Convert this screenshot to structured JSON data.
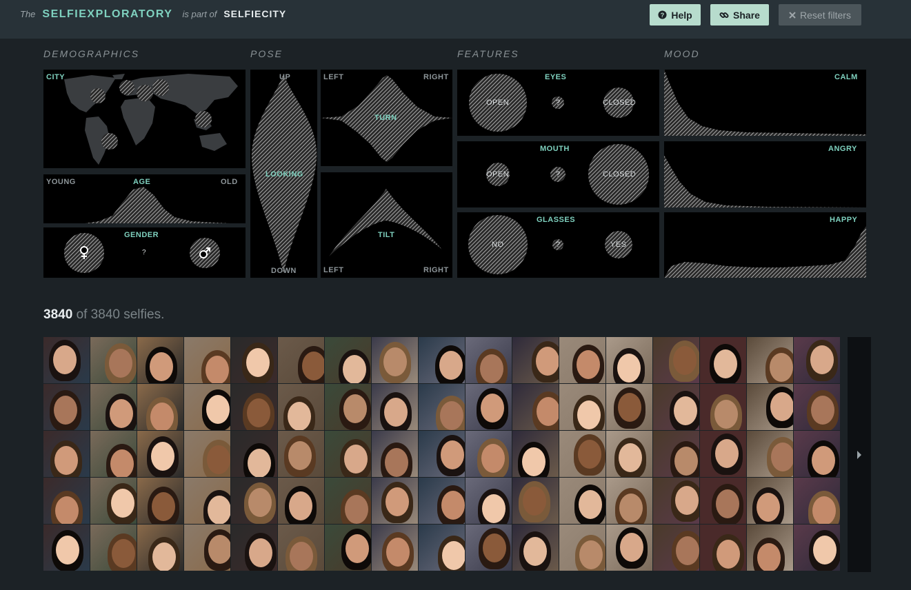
{
  "header": {
    "the": "The",
    "brand": "SELFIEXPLORATORY",
    "part_of": "is part of",
    "parent": "SELFIECITY",
    "help_label": "Help",
    "share_label": "Share",
    "reset_label": "Reset filters"
  },
  "sections": {
    "demographics": "DEMOGRAPHICS",
    "pose": "POSE",
    "features": "FEATURES",
    "mood": "MOOD"
  },
  "demographics": {
    "city": "CITY",
    "age": {
      "young": "YOUNG",
      "title": "AGE",
      "old": "OLD"
    },
    "gender": {
      "title": "GENDER",
      "unknown": "?"
    }
  },
  "pose": {
    "up": "UP",
    "looking": "LOOKING",
    "down": "DOWN",
    "turn": {
      "left": "LEFT",
      "title": "TURN",
      "right": "RIGHT"
    },
    "tilt": {
      "title": "TILT",
      "left": "LEFT",
      "right": "RIGHT"
    }
  },
  "features": {
    "eyes": {
      "title": "EYES",
      "open": "OPEN",
      "unknown": "?",
      "closed": "CLOSED"
    },
    "mouth": {
      "title": "MOUTH",
      "open": "OPEN",
      "unknown": "?",
      "closed": "CLOSED"
    },
    "glasses": {
      "title": "GLASSES",
      "no": "NO",
      "unknown": "?",
      "yes": "YES"
    }
  },
  "mood": {
    "calm": "CALM",
    "angry": "ANGRY",
    "happy": "HAPPY"
  },
  "results": {
    "shown": "3840",
    "rest": "of 3840 selfies."
  },
  "colors": {
    "accent": "#7fd1bf",
    "button": "#b7dccd",
    "background": "#1c2226",
    "topbar": "#283238"
  },
  "grid": {
    "rows": 5,
    "columns": 17,
    "next_icon": "chevron-right-icon"
  }
}
